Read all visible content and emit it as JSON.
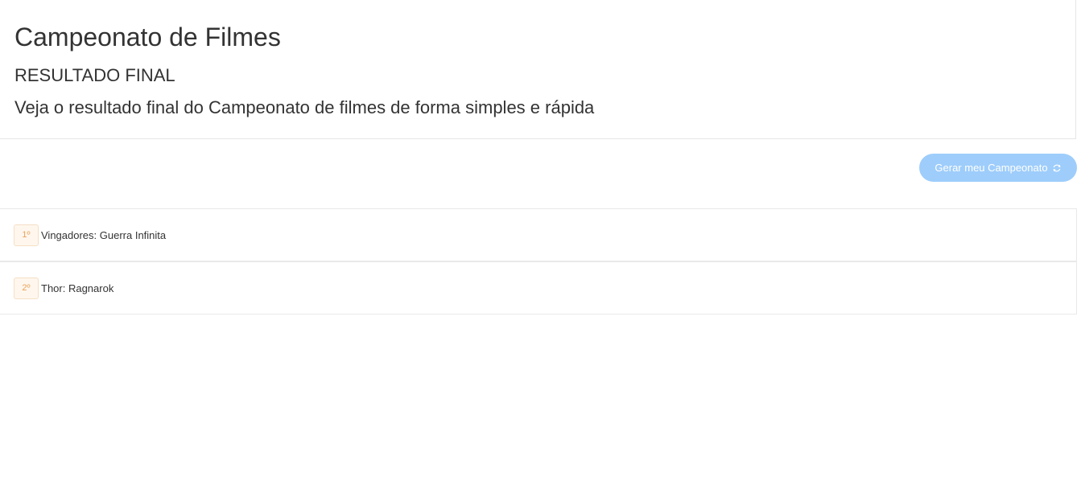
{
  "header": {
    "title": "Campeonato de Filmes",
    "subtitle": "RESULTADO FINAL",
    "lead": "Veja o resultado final do Campeonato de filmes de forma simples e rápida"
  },
  "actions": {
    "generate_label": "Gerar meu Campeonato",
    "generate_icon": "refresh-icon",
    "button_color": "#9ecdfb"
  },
  "ranking": [
    {
      "position": "1º",
      "title": "Vingadores: Guerra Infinita"
    },
    {
      "position": "2º",
      "title": "Thor: Ragnarok"
    }
  ],
  "colors": {
    "badge_text": "#e9a25a",
    "badge_background": "#fff7ee"
  }
}
